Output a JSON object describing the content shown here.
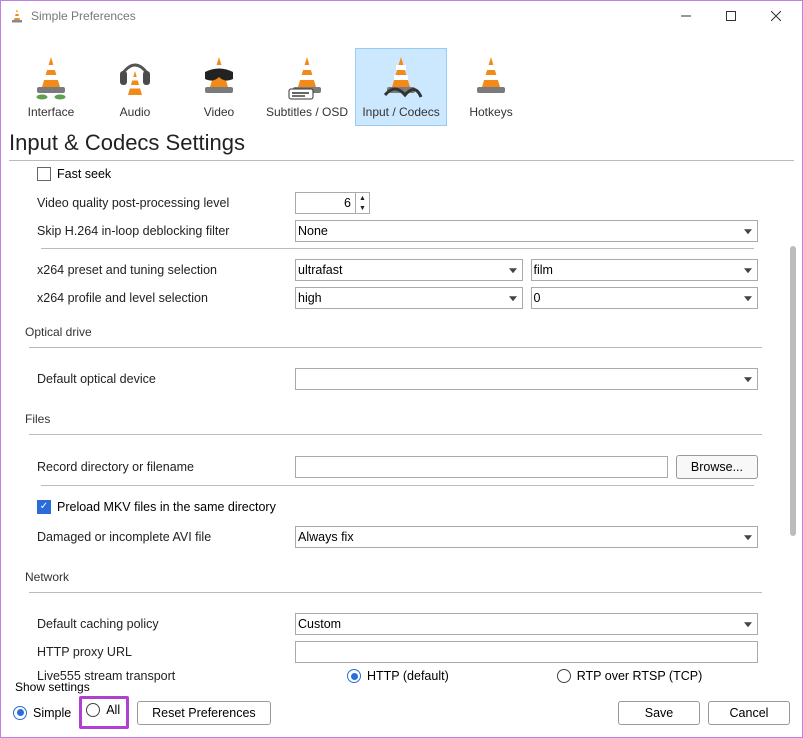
{
  "window": {
    "title": "Simple Preferences"
  },
  "categories": [
    {
      "label": "Interface",
      "selected": false
    },
    {
      "label": "Audio",
      "selected": false
    },
    {
      "label": "Video",
      "selected": false
    },
    {
      "label": "Subtitles / OSD",
      "selected": false
    },
    {
      "label": "Input / Codecs",
      "selected": true
    },
    {
      "label": "Hotkeys",
      "selected": false
    }
  ],
  "page": {
    "heading": "Input & Codecs Settings"
  },
  "codecs_top": {
    "fast_seek_label": "Fast seek",
    "fast_seek_checked": false,
    "vq_label": "Video quality post-processing level",
    "vq_value": "6",
    "skip_h264_label": "Skip H.264 in-loop deblocking filter",
    "skip_h264_value": "None",
    "x264_preset_label": "x264 preset and tuning selection",
    "x264_preset_value": "ultrafast",
    "x264_tune_value": "film",
    "x264_profile_label": "x264 profile and level selection",
    "x264_profile_value": "high",
    "x264_level_value": "0"
  },
  "optical": {
    "legend": "Optical drive",
    "default_device_label": "Default optical device",
    "default_device_value": ""
  },
  "files": {
    "legend": "Files",
    "record_dir_label": "Record directory or filename",
    "record_dir_value": "",
    "browse_label": "Browse...",
    "preload_mkv_label": "Preload MKV files in the same directory",
    "preload_mkv_checked": true,
    "avi_label": "Damaged or incomplete AVI file",
    "avi_value": "Always fix"
  },
  "network": {
    "legend": "Network",
    "caching_label": "Default caching policy",
    "caching_value": "Custom",
    "proxy_label": "HTTP proxy URL",
    "proxy_value": "",
    "live555_label": "Live555 stream transport",
    "live555_http_label": "HTTP (default)",
    "live555_rtp_label": "RTP over RTSP (TCP)",
    "live555_selected": "http"
  },
  "footer": {
    "show_settings_label": "Show settings",
    "simple_label": "Simple",
    "all_label": "All",
    "mode_selected": "simple",
    "reset_label": "Reset Preferences",
    "save_label": "Save",
    "cancel_label": "Cancel"
  }
}
